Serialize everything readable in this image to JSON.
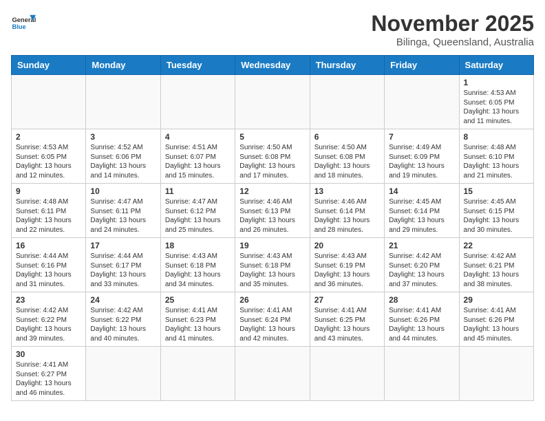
{
  "header": {
    "logo_general": "General",
    "logo_blue": "Blue",
    "month_title": "November 2025",
    "location": "Bilinga, Queensland, Australia"
  },
  "days_of_week": [
    "Sunday",
    "Monday",
    "Tuesday",
    "Wednesday",
    "Thursday",
    "Friday",
    "Saturday"
  ],
  "weeks": [
    [
      {
        "day": "",
        "info": ""
      },
      {
        "day": "",
        "info": ""
      },
      {
        "day": "",
        "info": ""
      },
      {
        "day": "",
        "info": ""
      },
      {
        "day": "",
        "info": ""
      },
      {
        "day": "",
        "info": ""
      },
      {
        "day": "1",
        "info": "Sunrise: 4:53 AM\nSunset: 6:05 PM\nDaylight: 13 hours\nand 11 minutes."
      }
    ],
    [
      {
        "day": "2",
        "info": "Sunrise: 4:53 AM\nSunset: 6:05 PM\nDaylight: 13 hours\nand 12 minutes."
      },
      {
        "day": "3",
        "info": "Sunrise: 4:52 AM\nSunset: 6:06 PM\nDaylight: 13 hours\nand 14 minutes."
      },
      {
        "day": "4",
        "info": "Sunrise: 4:51 AM\nSunset: 6:07 PM\nDaylight: 13 hours\nand 15 minutes."
      },
      {
        "day": "5",
        "info": "Sunrise: 4:50 AM\nSunset: 6:08 PM\nDaylight: 13 hours\nand 17 minutes."
      },
      {
        "day": "6",
        "info": "Sunrise: 4:50 AM\nSunset: 6:08 PM\nDaylight: 13 hours\nand 18 minutes."
      },
      {
        "day": "7",
        "info": "Sunrise: 4:49 AM\nSunset: 6:09 PM\nDaylight: 13 hours\nand 19 minutes."
      },
      {
        "day": "8",
        "info": "Sunrise: 4:48 AM\nSunset: 6:10 PM\nDaylight: 13 hours\nand 21 minutes."
      }
    ],
    [
      {
        "day": "9",
        "info": "Sunrise: 4:48 AM\nSunset: 6:11 PM\nDaylight: 13 hours\nand 22 minutes."
      },
      {
        "day": "10",
        "info": "Sunrise: 4:47 AM\nSunset: 6:11 PM\nDaylight: 13 hours\nand 24 minutes."
      },
      {
        "day": "11",
        "info": "Sunrise: 4:47 AM\nSunset: 6:12 PM\nDaylight: 13 hours\nand 25 minutes."
      },
      {
        "day": "12",
        "info": "Sunrise: 4:46 AM\nSunset: 6:13 PM\nDaylight: 13 hours\nand 26 minutes."
      },
      {
        "day": "13",
        "info": "Sunrise: 4:46 AM\nSunset: 6:14 PM\nDaylight: 13 hours\nand 28 minutes."
      },
      {
        "day": "14",
        "info": "Sunrise: 4:45 AM\nSunset: 6:14 PM\nDaylight: 13 hours\nand 29 minutes."
      },
      {
        "day": "15",
        "info": "Sunrise: 4:45 AM\nSunset: 6:15 PM\nDaylight: 13 hours\nand 30 minutes."
      }
    ],
    [
      {
        "day": "16",
        "info": "Sunrise: 4:44 AM\nSunset: 6:16 PM\nDaylight: 13 hours\nand 31 minutes."
      },
      {
        "day": "17",
        "info": "Sunrise: 4:44 AM\nSunset: 6:17 PM\nDaylight: 13 hours\nand 33 minutes."
      },
      {
        "day": "18",
        "info": "Sunrise: 4:43 AM\nSunset: 6:18 PM\nDaylight: 13 hours\nand 34 minutes."
      },
      {
        "day": "19",
        "info": "Sunrise: 4:43 AM\nSunset: 6:18 PM\nDaylight: 13 hours\nand 35 minutes."
      },
      {
        "day": "20",
        "info": "Sunrise: 4:43 AM\nSunset: 6:19 PM\nDaylight: 13 hours\nand 36 minutes."
      },
      {
        "day": "21",
        "info": "Sunrise: 4:42 AM\nSunset: 6:20 PM\nDaylight: 13 hours\nand 37 minutes."
      },
      {
        "day": "22",
        "info": "Sunrise: 4:42 AM\nSunset: 6:21 PM\nDaylight: 13 hours\nand 38 minutes."
      }
    ],
    [
      {
        "day": "23",
        "info": "Sunrise: 4:42 AM\nSunset: 6:22 PM\nDaylight: 13 hours\nand 39 minutes."
      },
      {
        "day": "24",
        "info": "Sunrise: 4:42 AM\nSunset: 6:22 PM\nDaylight: 13 hours\nand 40 minutes."
      },
      {
        "day": "25",
        "info": "Sunrise: 4:41 AM\nSunset: 6:23 PM\nDaylight: 13 hours\nand 41 minutes."
      },
      {
        "day": "26",
        "info": "Sunrise: 4:41 AM\nSunset: 6:24 PM\nDaylight: 13 hours\nand 42 minutes."
      },
      {
        "day": "27",
        "info": "Sunrise: 4:41 AM\nSunset: 6:25 PM\nDaylight: 13 hours\nand 43 minutes."
      },
      {
        "day": "28",
        "info": "Sunrise: 4:41 AM\nSunset: 6:26 PM\nDaylight: 13 hours\nand 44 minutes."
      },
      {
        "day": "29",
        "info": "Sunrise: 4:41 AM\nSunset: 6:26 PM\nDaylight: 13 hours\nand 45 minutes."
      }
    ],
    [
      {
        "day": "30",
        "info": "Sunrise: 4:41 AM\nSunset: 6:27 PM\nDaylight: 13 hours\nand 46 minutes."
      },
      {
        "day": "",
        "info": ""
      },
      {
        "day": "",
        "info": ""
      },
      {
        "day": "",
        "info": ""
      },
      {
        "day": "",
        "info": ""
      },
      {
        "day": "",
        "info": ""
      },
      {
        "day": "",
        "info": ""
      }
    ]
  ]
}
